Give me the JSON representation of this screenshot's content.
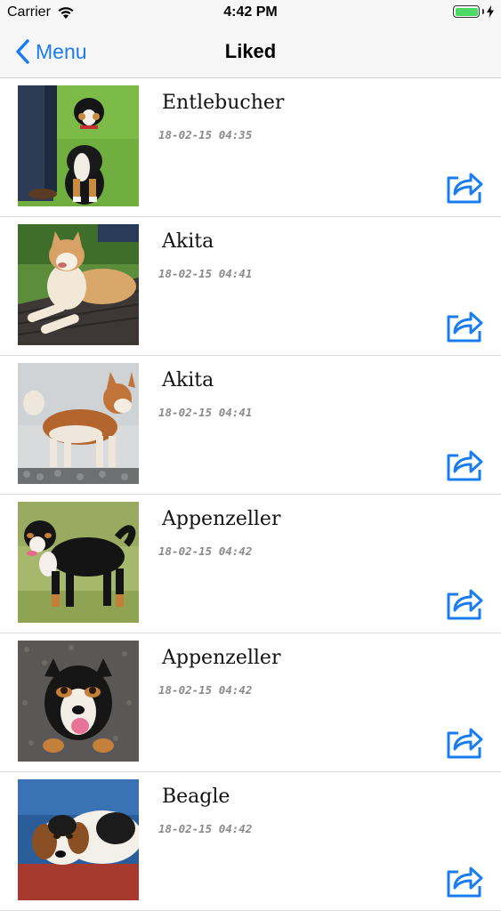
{
  "status_bar": {
    "carrier": "Carrier",
    "time": "4:42 PM",
    "wifi_icon": "wifi-icon",
    "battery_icon": "battery-icon",
    "charging_icon": "bolt-icon"
  },
  "nav": {
    "back_label": "Menu",
    "title": "Liked",
    "accent_color": "#1a7cf2"
  },
  "items": [
    {
      "name": "Entlebucher",
      "date": "18-02-15 04:35",
      "share_icon": "share-icon"
    },
    {
      "name": "Akita",
      "date": "18-02-15 04:41",
      "share_icon": "share-icon"
    },
    {
      "name": "Akita",
      "date": "18-02-15 04:41",
      "share_icon": "share-icon"
    },
    {
      "name": "Appenzeller",
      "date": "18-02-15 04:42",
      "share_icon": "share-icon"
    },
    {
      "name": "Appenzeller",
      "date": "18-02-15 04:42",
      "share_icon": "share-icon"
    },
    {
      "name": "Beagle",
      "date": "18-02-15 04:42",
      "share_icon": "share-icon"
    }
  ]
}
